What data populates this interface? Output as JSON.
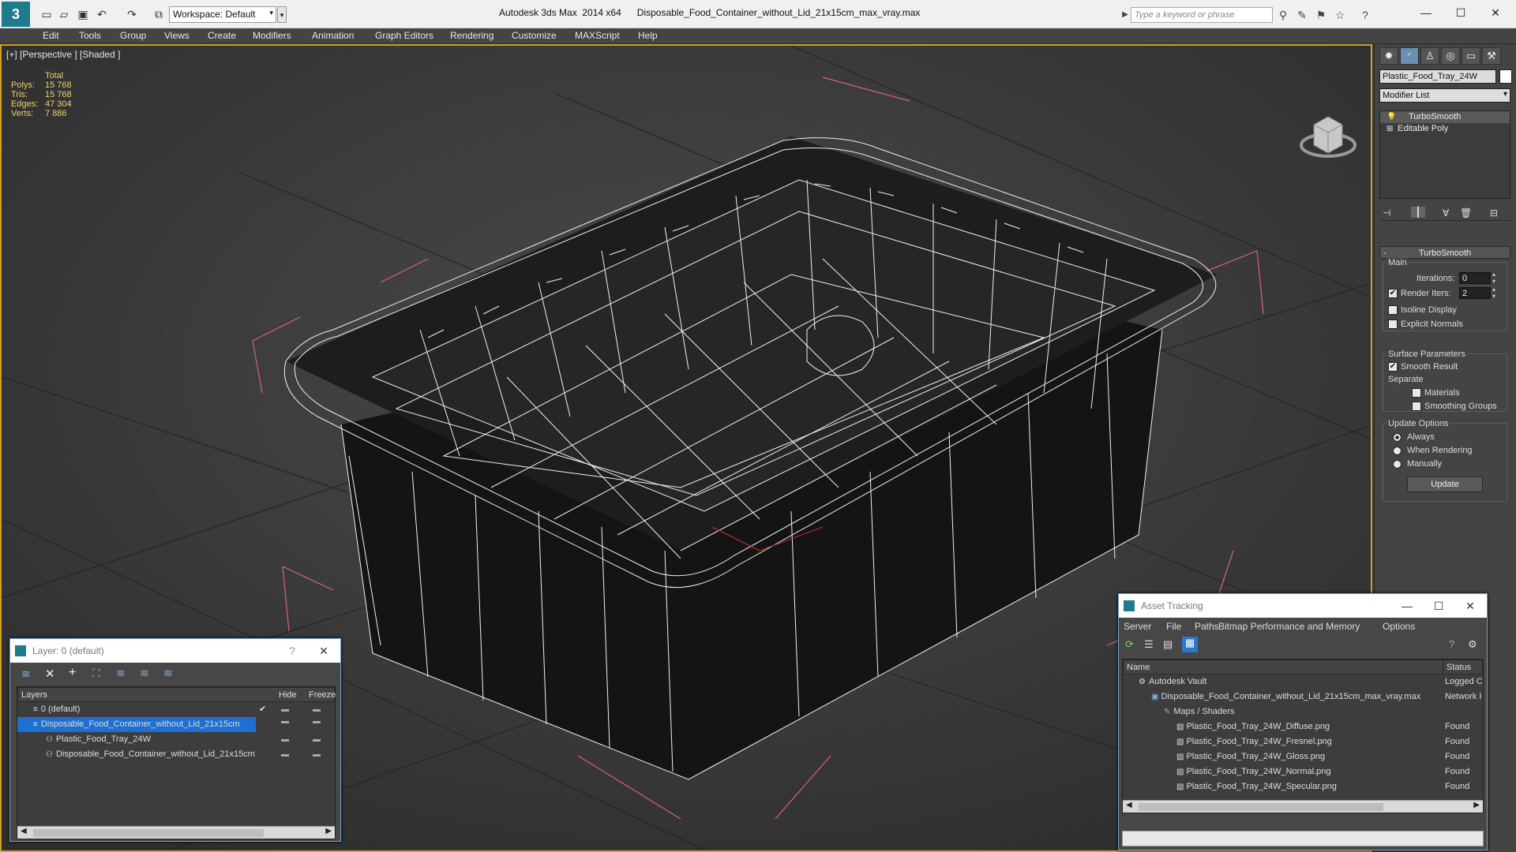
{
  "titlebar": {
    "workspace": "Workspace: Default",
    "app": "Autodesk 3ds Max  2014 x64",
    "file": "Disposable_Food_Container_without_Lid_21x15cm_max_vray.max",
    "search_placeholder": "Type a keyword or phrase"
  },
  "menu": [
    "Edit",
    "Tools",
    "Group",
    "Views",
    "Create",
    "Modifiers",
    "Animation",
    "Graph Editors",
    "Rendering",
    "Customize",
    "MAXScript",
    "Help"
  ],
  "viewport": {
    "label": "[+] [Perspective ] [Shaded ]",
    "stats": {
      "header": "Total",
      "rows": [
        {
          "k": "Polys:",
          "v": "15 768"
        },
        {
          "k": "Tris:",
          "v": "15 768"
        },
        {
          "k": "Edges:",
          "v": "47 304"
        },
        {
          "k": "Verts:",
          "v": "7 886"
        }
      ]
    }
  },
  "command_panel": {
    "object_name": "Plastic_Food_Tray_24W",
    "modifier_list": "Modifier List",
    "stack": [
      "TurboSmooth",
      "Editable Poly"
    ],
    "rollout_title": "TurboSmooth",
    "main_group": "Main",
    "iterations_label": "Iterations:",
    "iterations_value": "0",
    "render_iters_label": "Render Iters:",
    "render_iters_value": "2",
    "isoline": "Isoline Display",
    "explicit_normals": "Explicit Normals",
    "surface_group": "Surface Parameters",
    "smooth_result": "Smooth Result",
    "separate": "Separate",
    "materials": "Materials",
    "smoothing_groups": "Smoothing Groups",
    "update_group": "Update Options",
    "always": "Always",
    "when_rendering": "When Rendering",
    "manually": "Manually",
    "update_button": "Update",
    "render_iters_checked": true,
    "smooth_result_checked": true
  },
  "layer_dialog": {
    "title": "Layer: 0 (default)",
    "help": "?",
    "col_layers": "Layers",
    "col_hide": "Hide",
    "col_freeze": "Freeze",
    "rows": [
      {
        "name": "0 (default)",
        "indent": 0,
        "selected": false
      },
      {
        "name": "Disposable_Food_Container_without_Lid_21x15cm",
        "indent": 0,
        "selected": true
      },
      {
        "name": "Plastic_Food_Tray_24W",
        "indent": 1,
        "selected": false
      },
      {
        "name": "Disposable_Food_Container_without_Lid_21x15cm",
        "indent": 1,
        "selected": false
      }
    ]
  },
  "asset_dialog": {
    "title": "Asset Tracking",
    "menu": [
      "Server",
      "File",
      "Paths",
      "Bitmap Performance and Memory",
      "Options"
    ],
    "col_name": "Name",
    "col_status": "Status",
    "rows": [
      {
        "name": "Autodesk Vault",
        "status": "Logged C",
        "indent": 0
      },
      {
        "name": "Disposable_Food_Container_without_Lid_21x15cm_max_vray.max",
        "status": "Network I",
        "indent": 1
      },
      {
        "name": "Maps / Shaders",
        "status": "",
        "indent": 2
      },
      {
        "name": "Plastic_Food_Tray_24W_Diffuse.png",
        "status": "Found",
        "indent": 3
      },
      {
        "name": "Plastic_Food_Tray_24W_Fresnel.png",
        "status": "Found",
        "indent": 3
      },
      {
        "name": "Plastic_Food_Tray_24W_Gloss.png",
        "status": "Found",
        "indent": 3
      },
      {
        "name": "Plastic_Food_Tray_24W_Normal.png",
        "status": "Found",
        "indent": 3
      },
      {
        "name": "Plastic_Food_Tray_24W_Specular.png",
        "status": "Found",
        "indent": 3
      }
    ]
  }
}
